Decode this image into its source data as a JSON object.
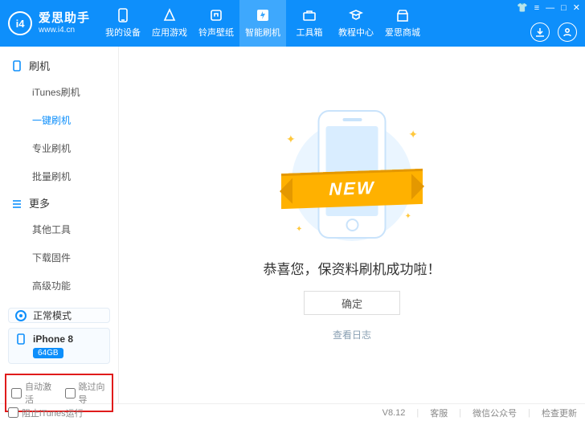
{
  "brand": {
    "logo_text": "i4",
    "name": "爱思助手",
    "url": "www.i4.cn"
  },
  "nav": [
    {
      "id": "device",
      "label": "我的设备"
    },
    {
      "id": "apps",
      "label": "应用游戏"
    },
    {
      "id": "ring",
      "label": "铃声壁纸"
    },
    {
      "id": "flash",
      "label": "智能刷机",
      "active": true
    },
    {
      "id": "toolbox",
      "label": "工具箱"
    },
    {
      "id": "tutorial",
      "label": "教程中心"
    },
    {
      "id": "store",
      "label": "爱思商城"
    }
  ],
  "sidebar": {
    "groups": [
      {
        "title": "刷机",
        "icon": "phone",
        "items": [
          {
            "id": "itunes",
            "label": "iTunes刷机"
          },
          {
            "id": "onekey",
            "label": "一键刷机",
            "active": true
          },
          {
            "id": "pro",
            "label": "专业刷机"
          },
          {
            "id": "batch",
            "label": "批量刷机"
          }
        ]
      },
      {
        "title": "更多",
        "icon": "more",
        "items": [
          {
            "id": "other",
            "label": "其他工具"
          },
          {
            "id": "firmware",
            "label": "下载固件"
          },
          {
            "id": "adv",
            "label": "高级功能"
          }
        ]
      }
    ],
    "mode_label": "正常模式",
    "device": {
      "name": "iPhone 8",
      "capacity": "64GB"
    },
    "options": {
      "auto_activate": "自动激活",
      "skip_wizard": "跳过向导"
    }
  },
  "main": {
    "ribbon": "NEW",
    "success_msg": "恭喜您，保资料刷机成功啦！",
    "ok_label": "确定",
    "log_link": "查看日志"
  },
  "status": {
    "block_itunes": "阻止iTunes运行",
    "version": "V8.12",
    "support": "客服",
    "wechat": "微信公众号",
    "update": "检查更新"
  }
}
